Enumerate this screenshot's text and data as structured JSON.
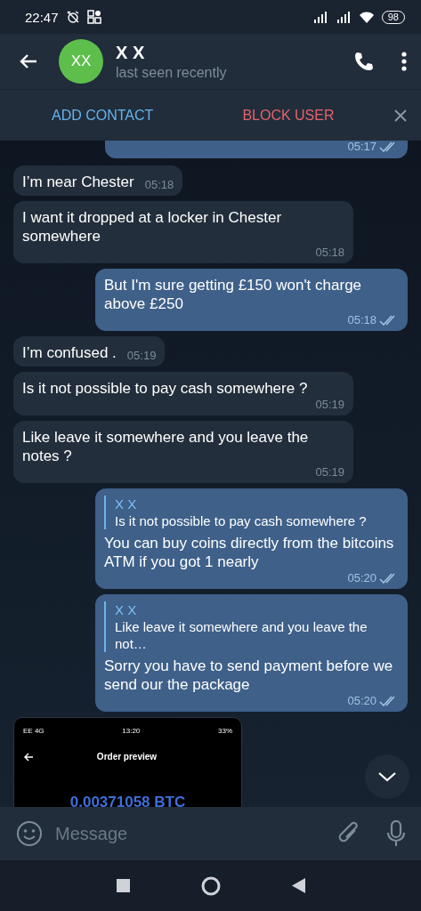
{
  "status_bar": {
    "time": "22:47",
    "battery": "98"
  },
  "header": {
    "name": "X X",
    "avatar": "XX",
    "status": "last seen recently"
  },
  "action_bar": {
    "add_contact": "ADD CONTACT",
    "block_user": "BLOCK USER"
  },
  "messages": [
    {
      "kind": "outgoing",
      "time": "05:17",
      "read": true
    },
    {
      "kind": "incoming",
      "text": "I’m near Chester",
      "time": "05:18"
    },
    {
      "kind": "incoming",
      "text": "I want it dropped at a locker in Chester somewhere",
      "time": "05:18"
    },
    {
      "kind": "outgoing",
      "text": "But I'm sure getting £150 won't charge above £250",
      "time": "05:18",
      "read": true
    },
    {
      "kind": "incoming",
      "text": "I’m confused .",
      "time": "05:19"
    },
    {
      "kind": "incoming",
      "text": "Is it not possible to pay cash somewhere ?",
      "time": "05:19"
    },
    {
      "kind": "incoming",
      "text": "Like leave it somewhere and you leave the notes ?",
      "time": "05:19"
    },
    {
      "kind": "outgoing",
      "reply": {
        "author": "X X",
        "text": "Is it not possible to pay cash somewhere ?"
      },
      "text": "You can buy coins directly from the bitcoins ATM if you got 1 nearly",
      "time": "05:20",
      "read": true
    },
    {
      "kind": "outgoing",
      "reply": {
        "author": "X X",
        "text": "Like leave it somewhere and you leave the not…"
      },
      "text": "Sorry you have to send payment before we send our the  package",
      "time": "05:20",
      "read": true
    },
    {
      "kind": "image",
      "screen": {
        "carrier": "EE 4G",
        "time": "13:20",
        "battery": "33%",
        "title": "Order preview",
        "amount": "0.00371058 BTC"
      }
    }
  ],
  "composer": {
    "placeholder": "Message"
  }
}
